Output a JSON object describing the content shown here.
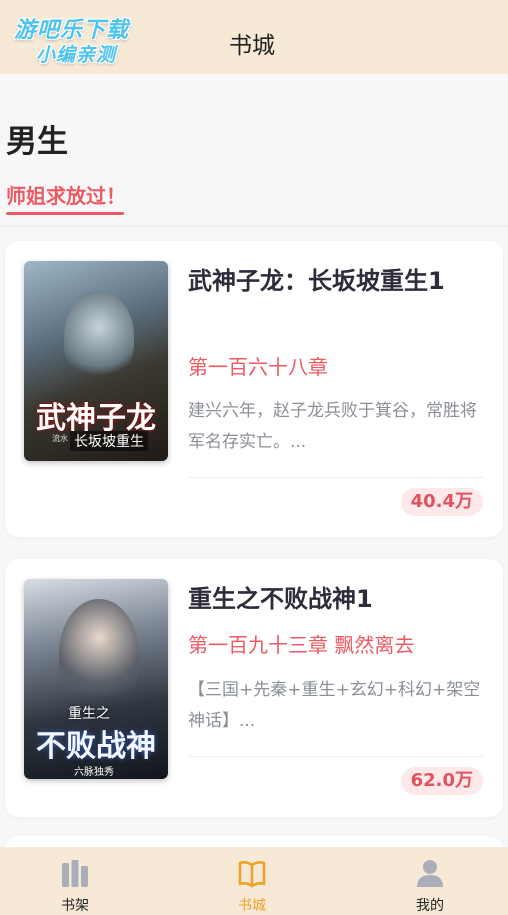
{
  "header": {
    "logo_line1": "游吧乐下载",
    "logo_line2": "小编亲测",
    "title": "书城"
  },
  "section": {
    "title": "男生",
    "active_tab": "师姐求放过！"
  },
  "books": [
    {
      "title": "武神子龙：长坂坡重生1",
      "chapter": "第一百六十八章",
      "description": "建兴六年，赵子龙兵败于箕谷，常胜将军名存实亡。...",
      "count": "40.4万",
      "cover_title": "武神子龙",
      "cover_subtitle": "长坂坡重生",
      "cover_author": "流水"
    },
    {
      "title": "重生之不败战神1",
      "chapter": "第一百九十三章 飘然离去",
      "description": "【三国+先秦+重生+玄幻+科幻+架空神话】...",
      "count": "62.0万",
      "cover_pre": "重生之",
      "cover_title": "不败战神",
      "cover_author": "六脉独秀"
    }
  ],
  "bottom_nav": {
    "items": [
      {
        "label": "书架",
        "icon": "bookshelf-icon"
      },
      {
        "label": "书城",
        "icon": "open-book-icon",
        "active": true
      },
      {
        "label": "我的",
        "icon": "user-icon"
      }
    ]
  },
  "colors": {
    "header_bg": "#f6ead6",
    "accent_red": "#ec5a64",
    "accent_orange": "#f0a12a",
    "badge_bg": "#fde8ea"
  }
}
